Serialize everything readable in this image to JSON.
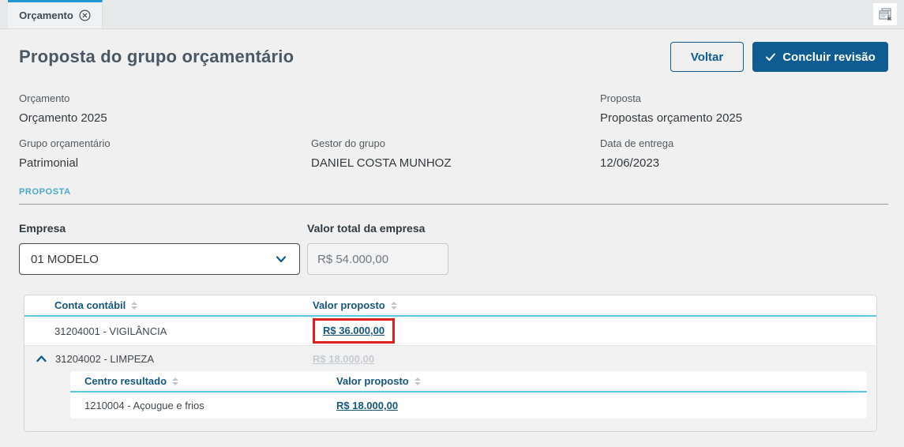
{
  "tab_bar": {
    "tab_label": "Orçamento"
  },
  "header": {
    "title": "Proposta do grupo orçamentário",
    "back_button": "Voltar",
    "conclude_button": "Concluir revisão"
  },
  "info": {
    "fields": [
      {
        "label": "Orçamento",
        "value": "Orçamento 2025"
      },
      {
        "label": "Proposta",
        "value": "Propostas orçamento 2025"
      },
      {
        "label": "Grupo orçamentário",
        "value": "Patrimonial"
      },
      {
        "label": "Gestor do grupo",
        "value": "DANIEL COSTA MUNHOZ"
      },
      {
        "label": "Data de entrega",
        "value": "12/06/2023"
      }
    ]
  },
  "section": {
    "label": "PROPOSTA"
  },
  "filters": {
    "company_label": "Empresa",
    "company_value": "01 MODELO",
    "total_label": "Valor total da empresa",
    "total_value": "R$ 54.000,00"
  },
  "accounts_table": {
    "headers": [
      "Conta contábil",
      "Valor proposto"
    ],
    "rows": [
      {
        "account": "31204001 - VIGILÂNCIA",
        "value": "R$ 36.000,00",
        "highlighted": true,
        "expanded": false
      },
      {
        "account": "31204002 - LIMPEZA",
        "value": "R$ 18.000,00",
        "highlighted": false,
        "expanded": true,
        "value_disabled": true
      }
    ]
  },
  "centers_table": {
    "headers": [
      "Centro resultado",
      "Valor proposto"
    ],
    "rows": [
      {
        "center": "1210004 - Açougue e frios",
        "value": "R$ 18.000,00"
      }
    ]
  },
  "colors": {
    "primary": "#0e5c92",
    "tab_accent": "#2196d3",
    "section_label": "#49a9c6",
    "table_header_text": "#15567f",
    "header_underline": "#59c5ec",
    "annotation_red": "#de1f1e",
    "disabled_link": "#c6ccd2"
  }
}
